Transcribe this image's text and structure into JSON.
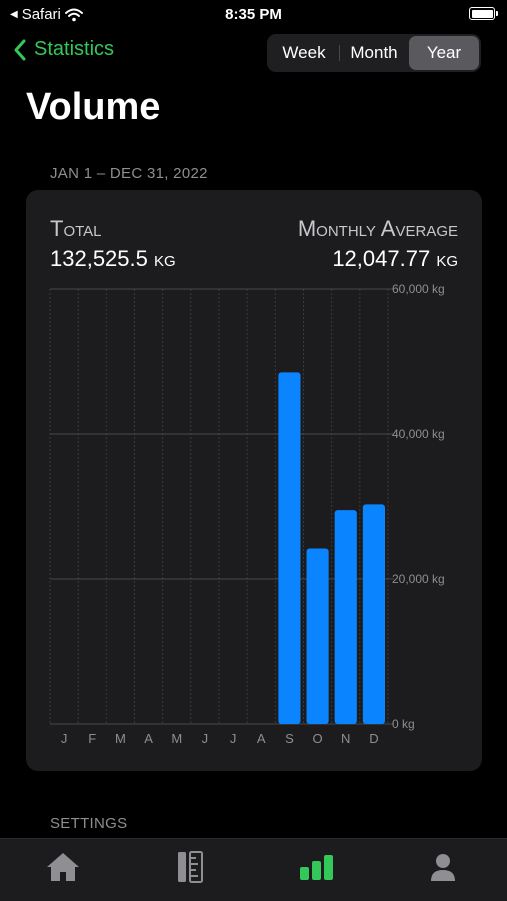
{
  "status_bar": {
    "back_app": "Safari",
    "time": "8:35 PM"
  },
  "nav": {
    "back_label": "Statistics"
  },
  "segments": [
    {
      "label": "Week",
      "active": false
    },
    {
      "label": "Month",
      "active": false
    },
    {
      "label": "Year",
      "active": true
    }
  ],
  "page": {
    "title": "Volume",
    "date_range": "JAN 1 – DEC 31, 2022"
  },
  "summary": {
    "total_label": "Total",
    "total_value": "132,525.5",
    "total_unit": "kg",
    "avg_label": "Monthly Average",
    "avg_value": "12,047.77",
    "avg_unit": "kg"
  },
  "chart_data": {
    "type": "bar",
    "categories": [
      "J",
      "F",
      "M",
      "A",
      "M",
      "J",
      "J",
      "A",
      "S",
      "O",
      "N",
      "D"
    ],
    "values": [
      0,
      0,
      0,
      0,
      0,
      0,
      0,
      0,
      48500,
      24200,
      29500,
      30300
    ],
    "ylim": [
      0,
      60000
    ],
    "yticks": [
      0,
      20000,
      40000,
      60000
    ],
    "ytick_labels": [
      "0 kg",
      "20,000 kg",
      "40,000 kg",
      "60,000 kg"
    ],
    "bar_color": "#0a84ff",
    "grid": true
  },
  "settings": {
    "label": "SETTINGS"
  },
  "tab_bar": {
    "items": [
      {
        "icon": "home-icon",
        "active": false
      },
      {
        "icon": "ruler-icon",
        "active": false
      },
      {
        "icon": "bar-chart-icon",
        "active": true
      },
      {
        "icon": "person-icon",
        "active": false
      }
    ]
  },
  "colors": {
    "accent": "#34c759",
    "bar": "#0a84ff",
    "card": "#1c1c1e"
  }
}
